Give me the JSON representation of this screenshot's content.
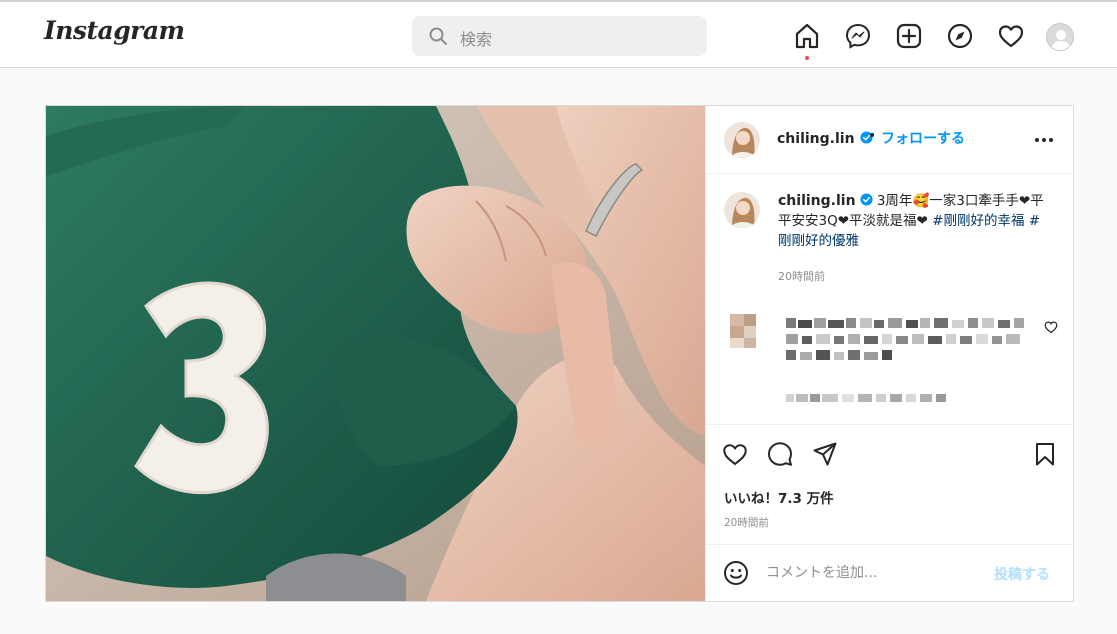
{
  "app": {
    "logo_text": "Instagram"
  },
  "search": {
    "placeholder": "検索"
  },
  "nav": {
    "icons": [
      "home-icon",
      "messenger-icon",
      "new-post-icon",
      "explore-icon",
      "activity-heart-icon",
      "profile-avatar"
    ],
    "active": "home-icon"
  },
  "post": {
    "author": {
      "username": "chiling.lin",
      "verified": true,
      "follow_label": "フォローする",
      "separator": "•"
    },
    "caption": {
      "username": "chiling.lin",
      "text_part1": " 3周年",
      "emoji": "🥰",
      "text_part2": "一家3口牽手手❤平平安安3Q❤平淡就是福❤ ",
      "hashtag1": "#剛剛好的幸福",
      "hashtag2": "#剛剛好的優雅",
      "time": "20時間前"
    },
    "likes_text": "いいね！7.3 万件",
    "time": "20時間前",
    "comment_box": {
      "placeholder": "コメントを追加...",
      "submit_label": "投稿する"
    },
    "image": {
      "description_icon": "photo",
      "jersey_number": "3"
    }
  },
  "colors": {
    "accent": "#0095f6",
    "link": "#00376b",
    "muted": "#8e8e8e",
    "notification": "#ed4956"
  }
}
